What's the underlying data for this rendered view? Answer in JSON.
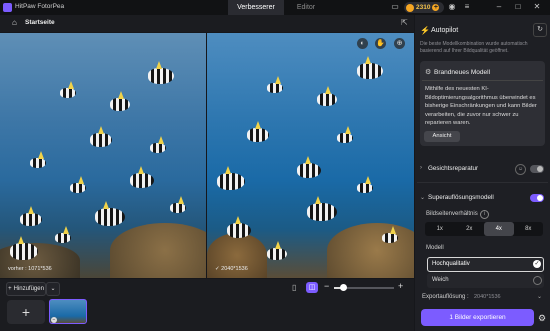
{
  "app": {
    "name": "HitPaw FotorPea"
  },
  "tabs": [
    {
      "label": "Verbesserer",
      "active": true
    },
    {
      "label": "Editor",
      "active": false
    }
  ],
  "credits": {
    "value": "2310"
  },
  "toolbar": {
    "home_label": "Startseite"
  },
  "preview": {
    "before_label": "vorher : 1071*536",
    "after_label": "2040*1536",
    "zoom_level": 0.15
  },
  "bottom": {
    "add_label": "Hinzufügen"
  },
  "panel": {
    "autopilot_label": "Autopilot",
    "autopilot_desc": "Die beste Modellkombination wurde automatisch basierend auf Ihrer Bildqualität geöffnet.",
    "card_title": "Brandneues Modell",
    "card_text": "Mithilfe des neuesten KI-Bildoptimierungsalgorithmus überwindet es bisherige Einschränkungen und kann Bilder verarbeiten, die zuvor nur schwer zu reparieren waren.",
    "card_button": "Ansicht",
    "face_label": "Gesichtsreparatur",
    "super_label": "Superauflösungsmodell",
    "ratio_label": "Bildseitenverhältnis",
    "ratios": [
      {
        "label": "1x"
      },
      {
        "label": "2x"
      },
      {
        "label": "4x",
        "selected": true
      },
      {
        "label": "8x"
      }
    ],
    "model_label": "Modell",
    "models": [
      {
        "label": "Hochqualitativ",
        "selected": true
      },
      {
        "label": "Weich"
      }
    ],
    "export_res_label": "Exportauflösung :",
    "export_res_value": "2040*1536",
    "export_button": "1 Bilder exportieren"
  },
  "colors": {
    "accent": "#7c5cff",
    "credit": "#f5a623",
    "autopilot": "#56d47a"
  }
}
